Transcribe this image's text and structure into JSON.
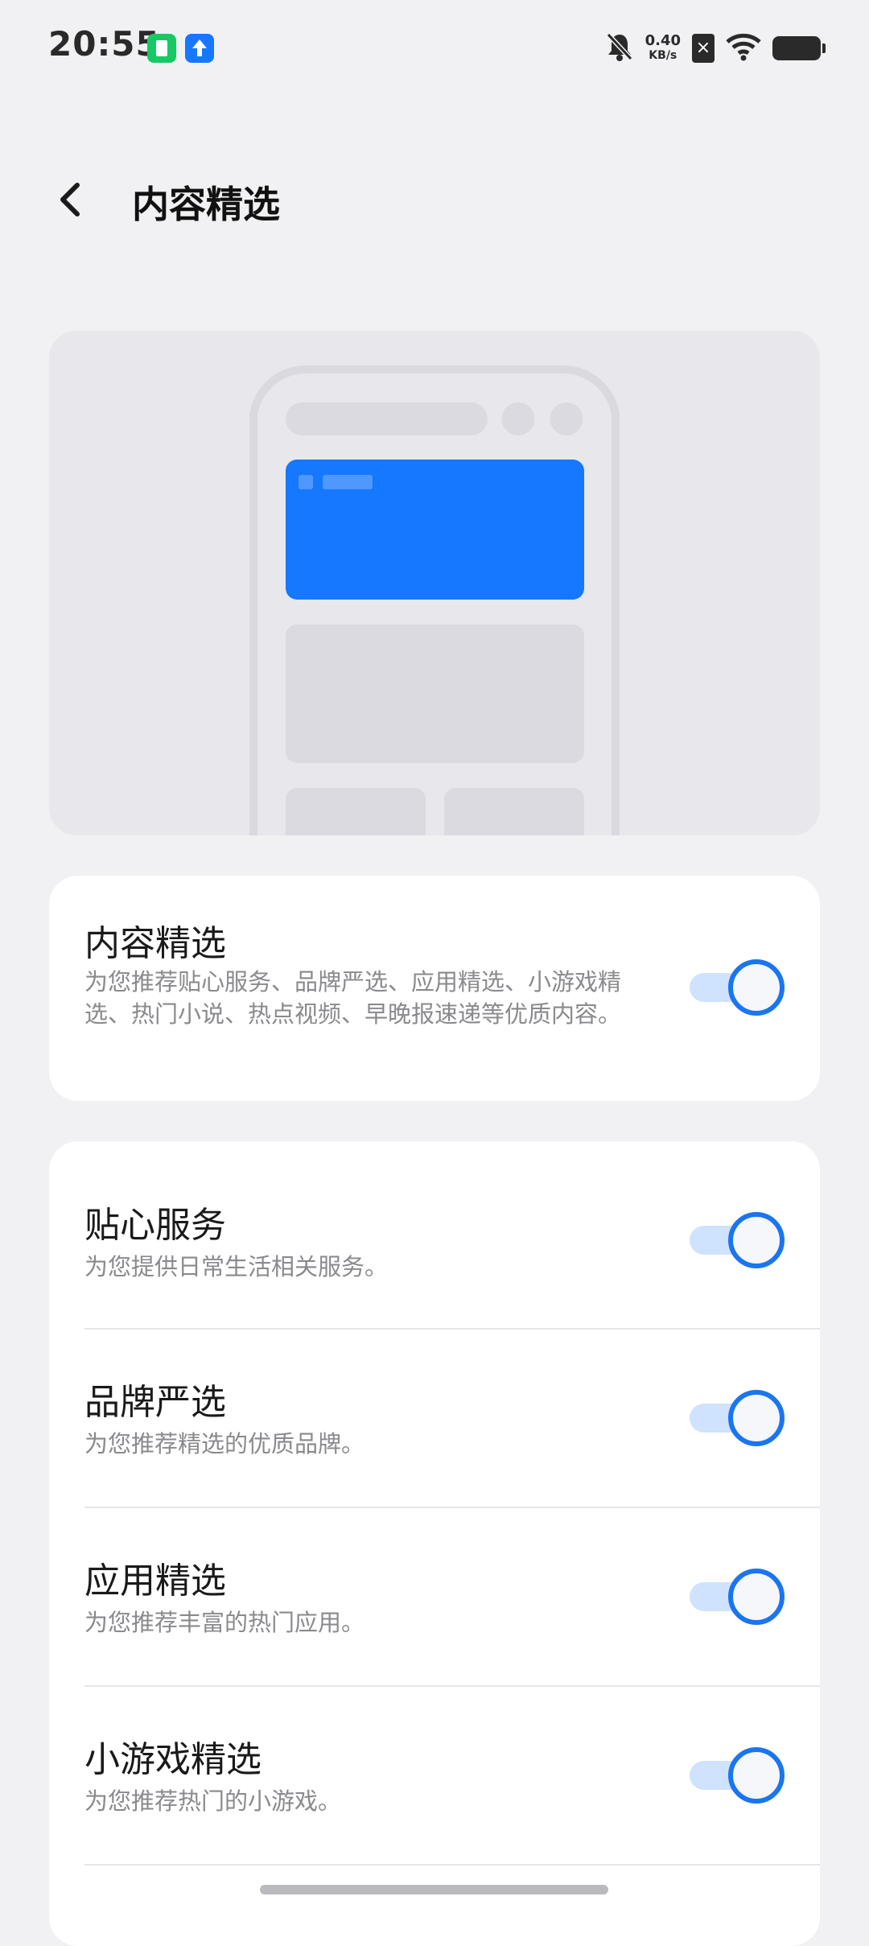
{
  "status": {
    "time": "20:55",
    "net_speed_value": "0.40",
    "net_speed_unit": "KB/s",
    "icons": [
      "app-notification-icon",
      "upload-notification-icon",
      "mute-bell-icon",
      "sim-off-icon",
      "wifi-icon",
      "battery-icon"
    ]
  },
  "header": {
    "title": "内容精选",
    "back_icon": "chevron-left-icon"
  },
  "colors": {
    "accent": "#1a75f0",
    "hero_blue": "#1677ff",
    "page_bg": "#f1f1f3"
  },
  "main_setting": {
    "title": "内容精选",
    "description": "为您推荐贴心服务、品牌严选、应用精选、小游戏精选、热门小说、热点视频、早晚报速递等优质内容。",
    "enabled": true
  },
  "settings": [
    {
      "title": "贴心服务",
      "description": "为您提供日常生活相关服务。",
      "enabled": true
    },
    {
      "title": "品牌严选",
      "description": "为您推荐精选的优质品牌。",
      "enabled": true
    },
    {
      "title": "应用精选",
      "description": "为您推荐丰富的热门应用。",
      "enabled": true
    },
    {
      "title": "小游戏精选",
      "description": "为您推荐热门的小游戏。",
      "enabled": true
    }
  ]
}
